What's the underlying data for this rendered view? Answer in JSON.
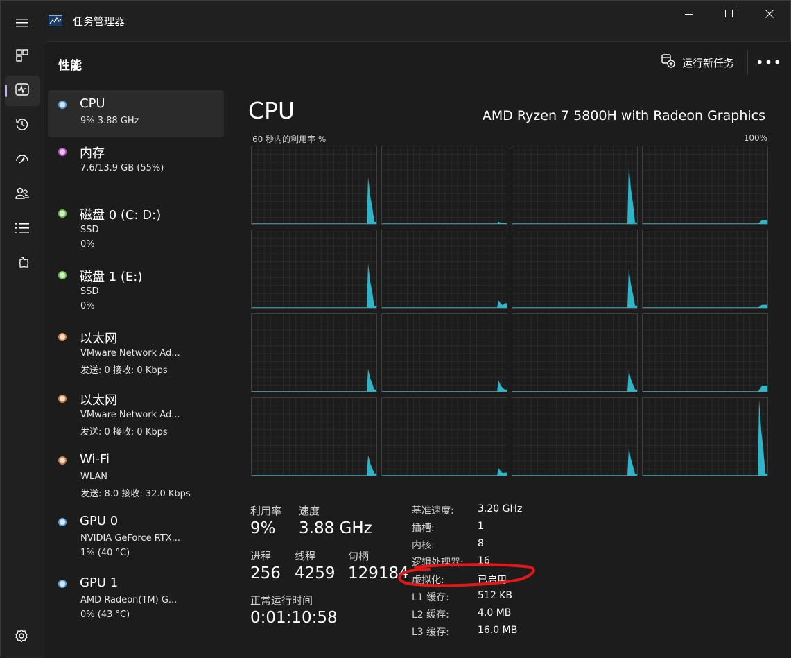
{
  "window": {
    "title": "任务管理器"
  },
  "header": {
    "page_title": "性能",
    "run_task_label": "运行新任务"
  },
  "nav": {
    "items": [
      {
        "icon": "processes-icon"
      },
      {
        "icon": "performance-icon",
        "active": true
      },
      {
        "icon": "app-history-icon"
      },
      {
        "icon": "startup-apps-icon"
      },
      {
        "icon": "users-icon"
      },
      {
        "icon": "details-icon"
      },
      {
        "icon": "services-icon"
      }
    ],
    "settings_icon": "settings-icon"
  },
  "resources": [
    {
      "name": "CPU",
      "sub1": "9% 3.88 GHz",
      "sub2": "",
      "dot": "#5ea0d8"
    },
    {
      "name": "内存",
      "sub1": "7.6/13.9 GB (55%)",
      "sub2": "",
      "dot": "#c050c0"
    },
    {
      "name": "磁盘 0 (C: D:)",
      "sub1": "SSD",
      "sub2": "0%",
      "dot": "#6ec050"
    },
    {
      "name": "磁盘 1 (E:)",
      "sub1": "SSD",
      "sub2": "0%",
      "dot": "#6ec050"
    },
    {
      "name": "以太网",
      "sub1": "VMware Network Ad...",
      "sub2": "发送: 0 接收: 0 Kbps",
      "dot": "#d08040"
    },
    {
      "name": "以太网",
      "sub1": "VMware Network Ad...",
      "sub2": "发送: 0 接收: 0 Kbps",
      "dot": "#d08040"
    },
    {
      "name": "Wi-Fi",
      "sub1": "WLAN",
      "sub2": "发送: 8.0 接收: 32.0 Kbps",
      "dot": "#d08040"
    },
    {
      "name": "GPU 0",
      "sub1": "NVIDIA GeForce RTX...",
      "sub2": "1% (40 °C)",
      "dot": "#5ea0d8"
    },
    {
      "name": "GPU 1",
      "sub1": "AMD Radeon(TM) G...",
      "sub2": "0% (43 °C)",
      "dot": "#5ea0d8"
    }
  ],
  "detail": {
    "title": "CPU",
    "model": "AMD Ryzen 7 5800H with Radeon Graphics",
    "graph_label": "60 秒内的利用率 %",
    "graph_max": "100%",
    "graph_color": "#2fb4c8",
    "core_graphs": [
      {
        "peak": 0.62,
        "tail": 0.03
      },
      {
        "peak": 0.03,
        "tail": 0.0
      },
      {
        "peak": 0.78,
        "tail": 0.02
      },
      {
        "peak": 0.0,
        "tail": 0.05
      },
      {
        "peak": 0.58,
        "tail": 0.02
      },
      {
        "peak": 0.1,
        "tail": 0.06
      },
      {
        "peak": 0.52,
        "tail": 0.03
      },
      {
        "peak": 0.0,
        "tail": 0.04
      },
      {
        "peak": 0.3,
        "tail": 0.03
      },
      {
        "peak": 0.15,
        "tail": 0.03
      },
      {
        "peak": 0.28,
        "tail": 0.03
      },
      {
        "peak": 0.0,
        "tail": 0.08
      },
      {
        "peak": 0.27,
        "tail": 0.03
      },
      {
        "peak": 0.1,
        "tail": 0.04
      },
      {
        "peak": 0.37,
        "tail": 0.02
      },
      {
        "peak": 1.0,
        "tail": 0.03
      }
    ]
  },
  "stats": {
    "utilization_label": "利用率",
    "utilization": "9%",
    "speed_label": "速度",
    "speed": "3.88 GHz",
    "processes_label": "进程",
    "processes": "256",
    "threads_label": "线程",
    "threads": "4259",
    "handles_label": "句柄",
    "handles": "129184",
    "uptime_label": "正常运行时间",
    "uptime": "0:01:10:58"
  },
  "specs": [
    {
      "label": "基准速度:",
      "value": "3.20 GHz"
    },
    {
      "label": "插槽:",
      "value": "1"
    },
    {
      "label": "内核:",
      "value": "8"
    },
    {
      "label": "逻辑处理器:",
      "value": "16"
    },
    {
      "label": "虚拟化:",
      "value": "已启用"
    },
    {
      "label": "L1 缓存:",
      "value": "512 KB"
    },
    {
      "label": "L2 缓存:",
      "value": "4.0 MB"
    },
    {
      "label": "L3 缓存:",
      "value": "16.0 MB"
    }
  ]
}
